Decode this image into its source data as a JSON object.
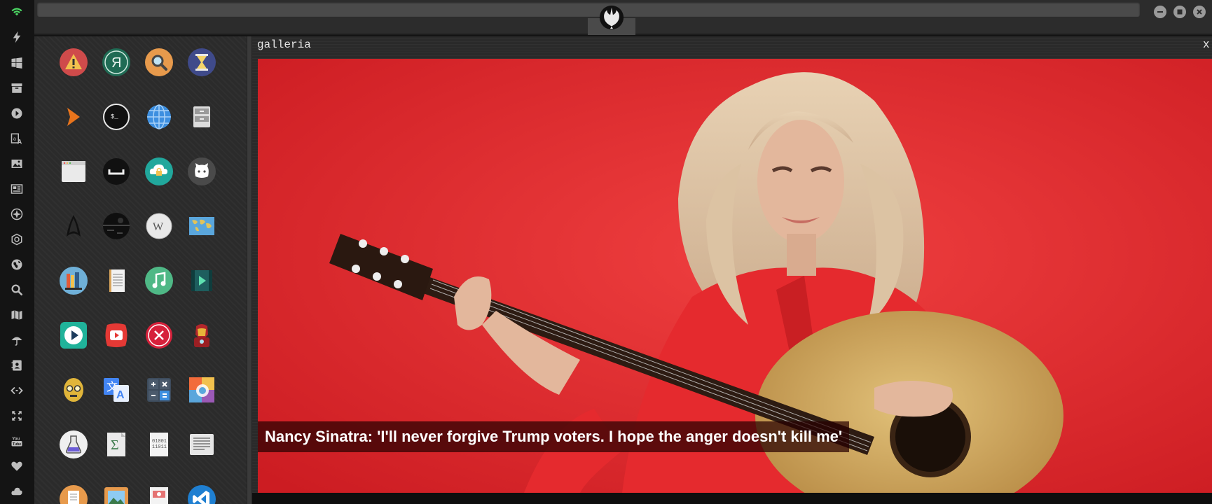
{
  "window": {
    "rebel_tab_icon": "rebel-alliance-icon",
    "controls": [
      "minimize-icon",
      "maximize-icon",
      "close-icon"
    ]
  },
  "rail": {
    "icons": [
      "wifi-icon",
      "flash-icon",
      "windows-icon",
      "archive-icon",
      "play-circle-icon",
      "translate-icon",
      "image-icon",
      "newspaper-icon",
      "jedi-icon",
      "empire-icon",
      "globe-icon",
      "search-icon",
      "map-icon",
      "umbrella-icon",
      "contacts-icon",
      "code-icon",
      "expand-icon",
      "youtube-icon",
      "heart-icon",
      "cloud-icon"
    ],
    "accent": "#4cd964"
  },
  "apps": [
    "warning-icon",
    "yandex-icon",
    "search-icon",
    "hourglass-icon",
    "terminal-arrow-icon",
    "terminal-icon",
    "globe-icon",
    "file-cabinet-icon",
    "browser-window-icon",
    "keyboard-space-icon",
    "cloud-lock-icon",
    "github-icon",
    "starfleet-icon",
    "death-star-icon",
    "wikipedia-icon",
    "world-map-icon",
    "library-icon",
    "notebook-icon",
    "music-icon",
    "video-icon",
    "play-icon",
    "youtube-icon",
    "x-circle-icon",
    "iron-man-icon",
    "c3po-icon",
    "translate-icon",
    "calculator-icon",
    "photo-gallery-icon",
    "flask-icon",
    "sigma-icon",
    "binary-file-icon",
    "text-document-icon",
    "document-icon",
    "picture-icon",
    "presentation-icon",
    "vscode-icon"
  ],
  "viewer": {
    "title": "galleria",
    "close_label": "x",
    "caption": "Nancy Sinatra: 'I'll never forgive Trump voters. I hope the anger doesn't kill me'",
    "background": "#e0242a"
  }
}
